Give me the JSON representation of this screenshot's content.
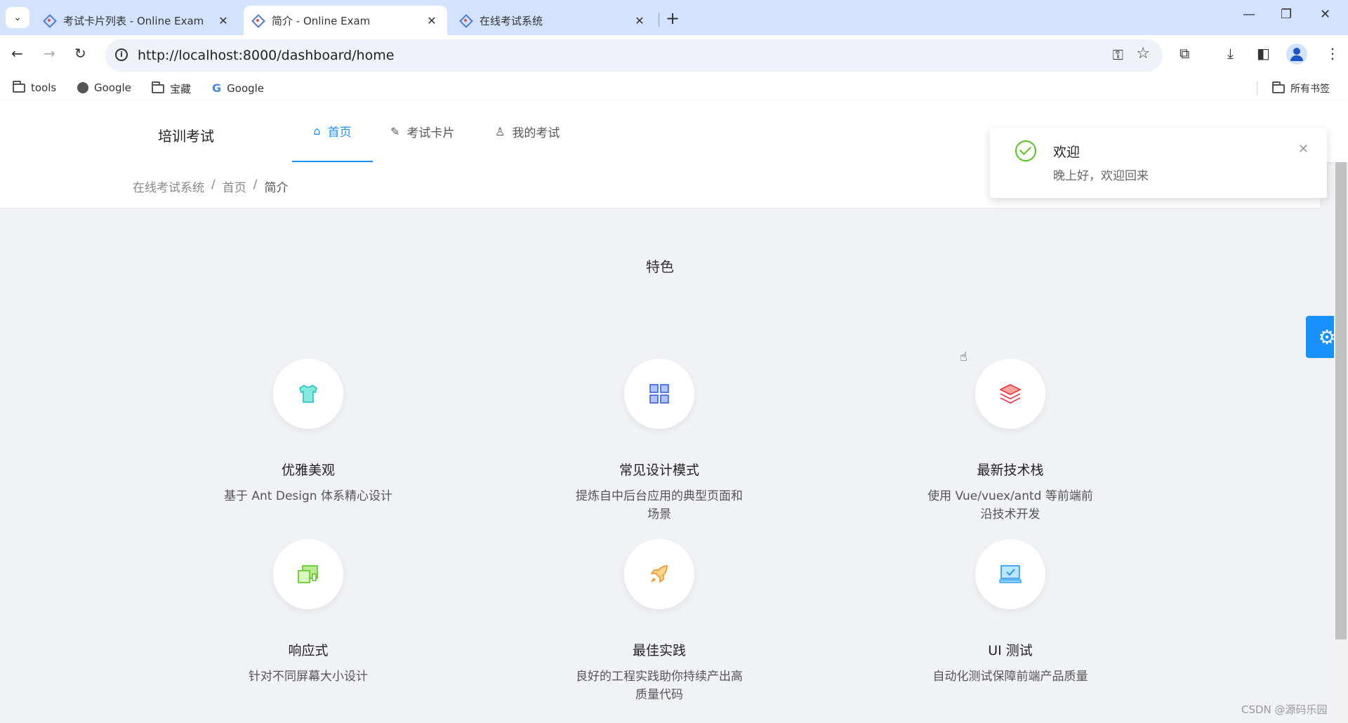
{
  "browser": {
    "tabs": [
      {
        "title": "考试卡片列表 - Online Exam",
        "active": false
      },
      {
        "title": "简介 - Online Exam",
        "active": true
      },
      {
        "title": "在线考试系统",
        "active": false
      }
    ],
    "url": "http://localhost:8000/dashboard/home",
    "bookmarks": [
      {
        "label": "tools",
        "icon": "folder-icon"
      },
      {
        "label": "Google",
        "icon": "globe-icon"
      },
      {
        "label": "宝藏",
        "icon": "folder-icon"
      },
      {
        "label": "Google",
        "icon": "google-icon"
      }
    ],
    "all_bookmarks": "所有书签"
  },
  "app": {
    "logo": "培训考试",
    "menu": [
      {
        "label": "首页",
        "icon": "home-icon",
        "active": true
      },
      {
        "label": "考试卡片",
        "icon": "card-icon",
        "active": false
      },
      {
        "label": "我的考试",
        "icon": "user-icon",
        "active": false
      }
    ],
    "breadcrumb": [
      "在线考试系统",
      "首页",
      "简介"
    ],
    "section_title": "特色",
    "features": [
      {
        "title": "优雅美观",
        "desc": "基于 Ant Design 体系精心设计",
        "icon": "shirt-icon",
        "color": "#36cfc9"
      },
      {
        "title": "常见设计模式",
        "desc": "提炼自中后台应用的典型页面和场景",
        "icon": "grid-icon",
        "color": "#597ef7"
      },
      {
        "title": "最新技术栈",
        "desc": "使用 Vue/vuex/antd 等前端前沿技术开发",
        "icon": "layers-icon",
        "color": "#f5222d"
      },
      {
        "title": "响应式",
        "desc": "针对不同屏幕大小设计",
        "icon": "devices-icon",
        "color": "#52c41a"
      },
      {
        "title": "最佳实践",
        "desc": "良好的工程实践助你持续产出高质量代码",
        "icon": "rocket-icon",
        "color": "#fa8c16"
      },
      {
        "title": "UI 测试",
        "desc": "自动化测试保障前端产品质量",
        "icon": "monitor-icon",
        "color": "#1890ff"
      }
    ],
    "notification": {
      "title": "欢迎",
      "desc": "晚上好，欢迎回来"
    }
  },
  "watermark": "CSDN @源码乐园"
}
